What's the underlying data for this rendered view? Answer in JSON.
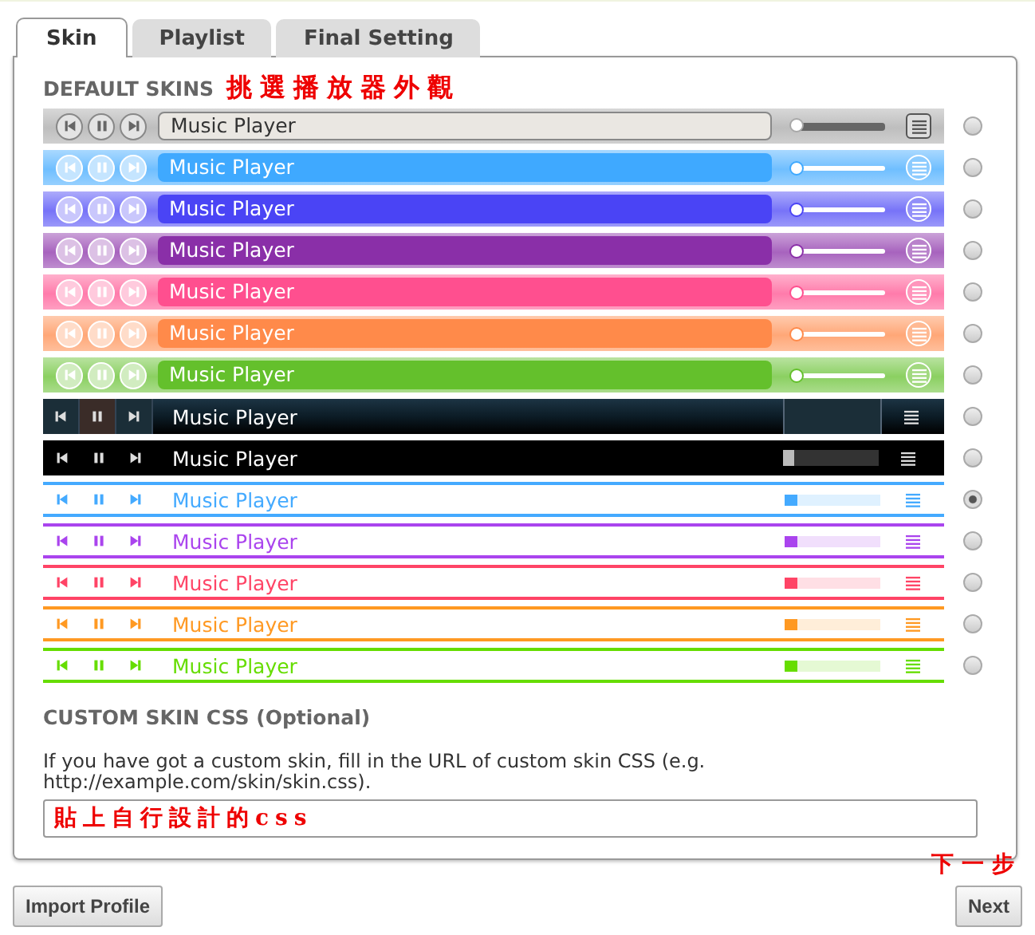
{
  "tabs": [
    {
      "label": "Skin",
      "selected": true
    },
    {
      "label": "Playlist",
      "selected": false
    },
    {
      "label": "Final Setting",
      "selected": false
    }
  ],
  "default_skins": {
    "heading": "DEFAULT SKINS",
    "annotation": "挑選播放器外觀",
    "skins": [
      {
        "kind": "silver",
        "color": "#a8a8a8",
        "title": "Music Player",
        "selected": false
      },
      {
        "kind": "glossy",
        "color": "#3fa9ff",
        "title": "Music Player",
        "selected": false
      },
      {
        "kind": "glossy",
        "color": "#4a44f5",
        "title": "Music Player",
        "selected": false
      },
      {
        "kind": "glossy",
        "color": "#8a2fa8",
        "title": "Music Player",
        "selected": false
      },
      {
        "kind": "glossy",
        "color": "#ff4f8f",
        "title": "Music Player",
        "selected": false
      },
      {
        "kind": "glossy",
        "color": "#ff8a4a",
        "title": "Music Player",
        "selected": false
      },
      {
        "kind": "glossy",
        "color": "#64c02c",
        "title": "Music Player",
        "selected": false
      },
      {
        "kind": "dark",
        "color": "#0c1c26",
        "title": "Music Player",
        "selected": false
      },
      {
        "kind": "black",
        "color": "#000000",
        "title": "Music Player",
        "selected": false
      },
      {
        "kind": "flat",
        "color": "#44aaff",
        "title": "Music Player",
        "selected": true
      },
      {
        "kind": "flat",
        "color": "#aa44ee",
        "title": "Music Player",
        "selected": false
      },
      {
        "kind": "flat",
        "color": "#ff4466",
        "title": "Music Player",
        "selected": false
      },
      {
        "kind": "flat",
        "color": "#ff9922",
        "title": "Music Player",
        "selected": false
      },
      {
        "kind": "flat",
        "color": "#66dd00",
        "title": "Music Player",
        "selected": false
      }
    ]
  },
  "custom_skin": {
    "heading": "CUSTOM SKIN CSS (Optional)",
    "description": "If you have got a custom skin, fill in the URL of custom skin CSS (e.g. http://example.com/skin/skin.css).",
    "value": "貼上自行設計的css"
  },
  "next_annotation": "下一步",
  "buttons": [
    {
      "label": "Import Profile"
    },
    {
      "label": "Next"
    }
  ]
}
